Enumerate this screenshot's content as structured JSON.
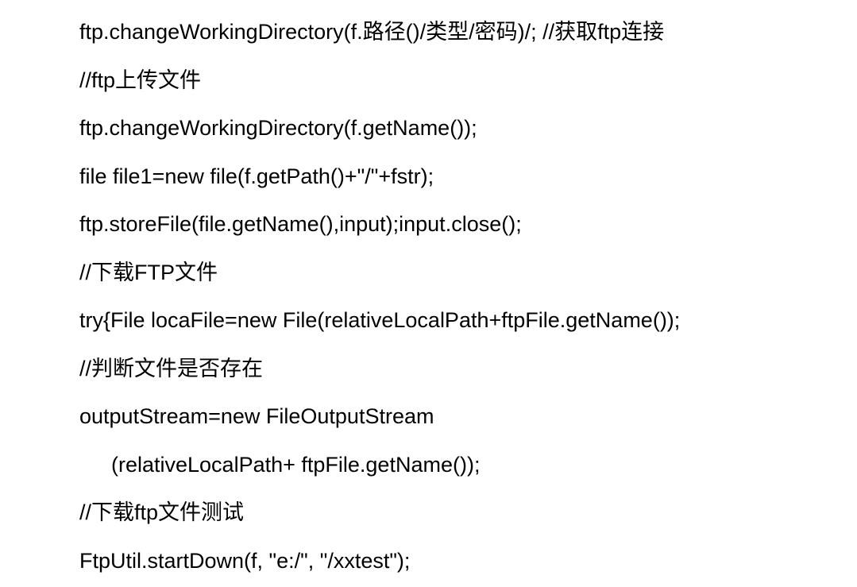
{
  "lines": [
    "ftp.changeWorkingDirectory(f.路径()/类型/密码)/; //获取ftp连接",
    "//ftp上传文件",
    "ftp.changeWorkingDirectory(f.getName());",
    "file file1=new file(f.getPath()+\"/\"+fstr);",
    "ftp.storeFile(file.getName(),input);input.close();",
    "//下载FTP文件",
    "try{File locaFile=new File(relativeLocalPath+ftpFile.getName());",
    "//判断文件是否存在",
    "outputStream=new FileOutputStream",
    "(relativeLocalPath+ ftpFile.getName());",
    "//下载ftp文件测试",
    "FtpUtil.startDown(f, \"e:/\", \"/xxtest\");"
  ],
  "indented": [
    false,
    false,
    false,
    false,
    false,
    false,
    false,
    false,
    false,
    true,
    false,
    false
  ]
}
